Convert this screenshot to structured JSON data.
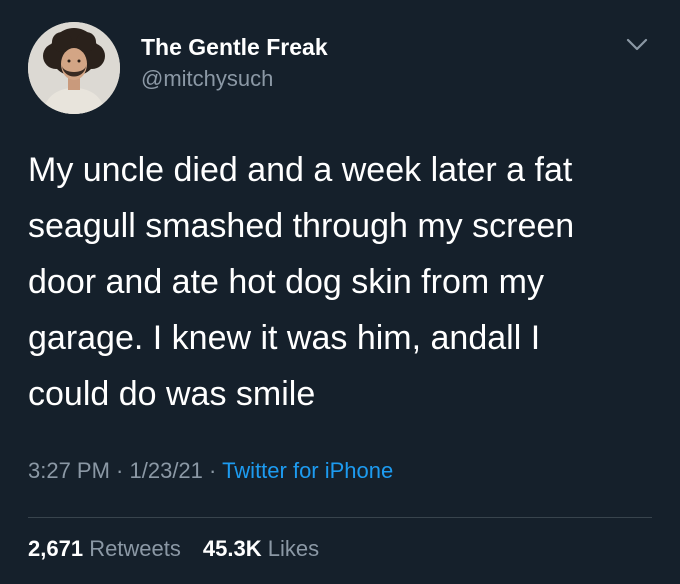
{
  "author": {
    "display_name": "The Gentle Freak",
    "handle": "@mitchysuch"
  },
  "icons": {
    "avatar": "avatar-photo",
    "menu": "chevron-down-icon"
  },
  "tweet": {
    "text_lines": [
      "My uncle died and a week later a fat",
      "seagull smashed through my screen",
      "door and ate hot dog skin from my",
      "garage. I  knew it was him, andall I",
      "could do was smile"
    ]
  },
  "meta": {
    "time": "3:27 PM",
    "sep1": " · ",
    "date": "1/23/21",
    "sep2": " · ",
    "source": "Twitter for iPhone"
  },
  "stats": {
    "retweets_count": "2,671",
    "retweets_label": "Retweets",
    "likes_count": "45.3K",
    "likes_label": "Likes"
  },
  "colors": {
    "background": "#15202b",
    "primary_text": "#ffffff",
    "secondary_text": "#8b98a5",
    "link": "#1d9bf0",
    "divider": "#38444d"
  }
}
